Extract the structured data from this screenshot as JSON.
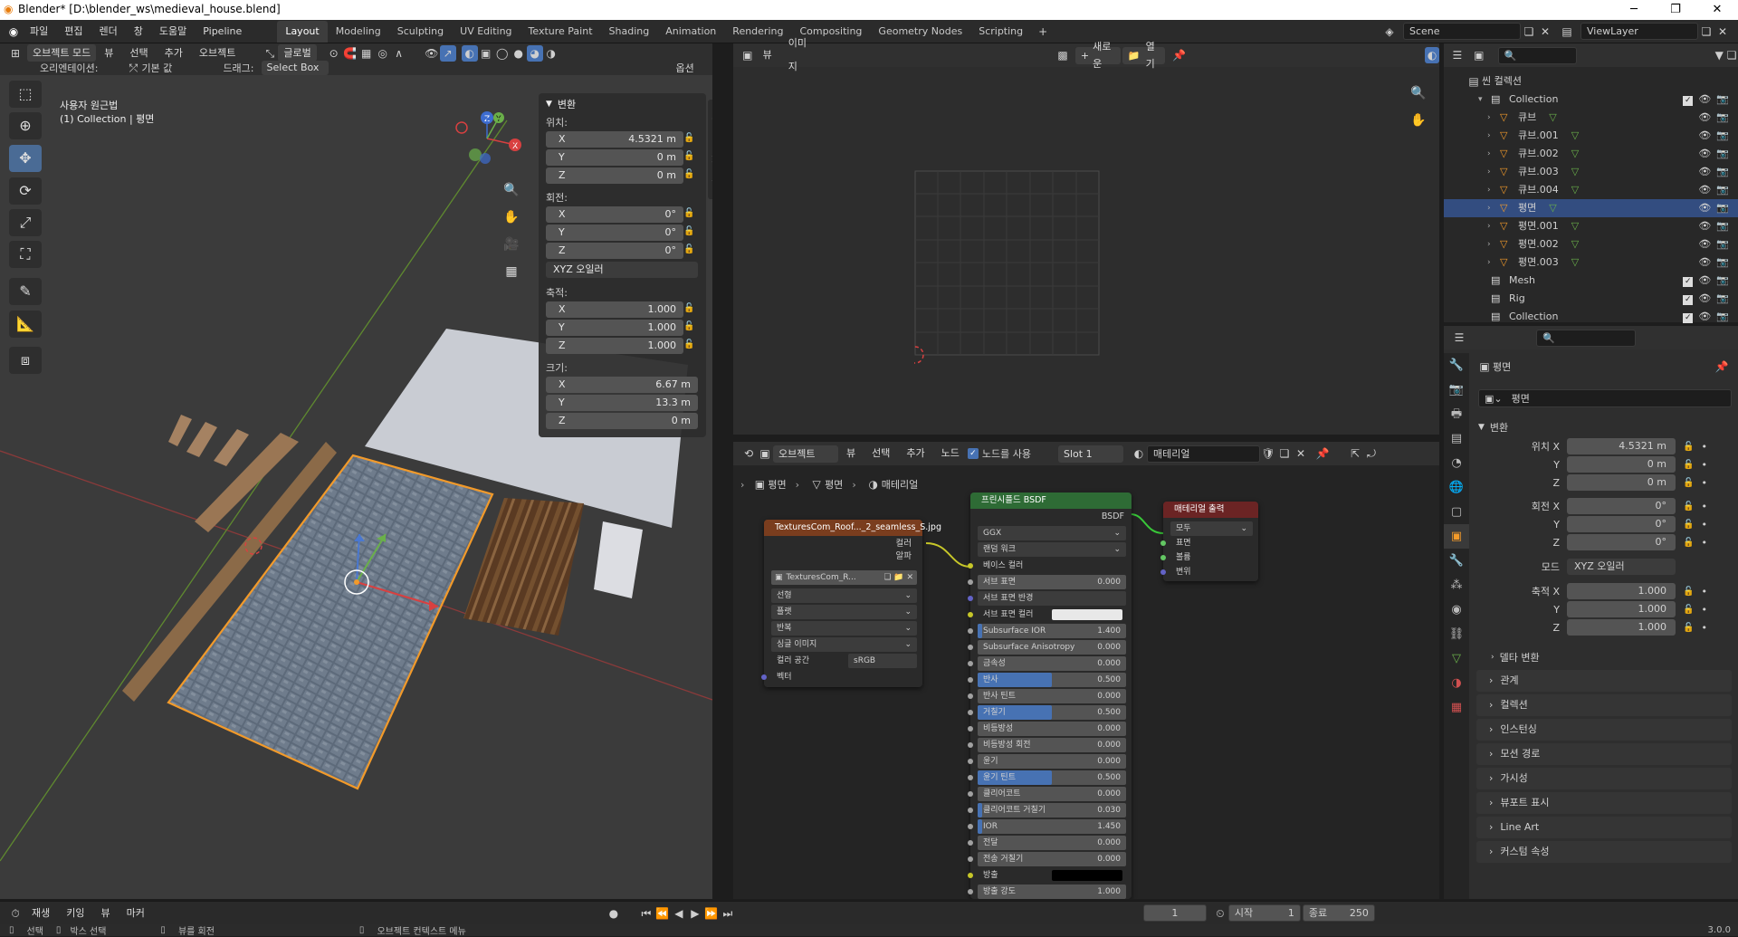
{
  "window": {
    "title": "Blender* [D:\\blender_ws\\medieval_house.blend]"
  },
  "menu": [
    "파일",
    "편집",
    "렌더",
    "창",
    "도움말",
    "Pipeline"
  ],
  "workspaces": [
    "Layout",
    "Modeling",
    "Sculpting",
    "UV Editing",
    "Texture Paint",
    "Shading",
    "Animation",
    "Rendering",
    "Compositing",
    "Geometry Nodes",
    "Scripting"
  ],
  "active_workspace": "Layout",
  "scene": {
    "name": "Scene",
    "view_layer": "ViewLayer"
  },
  "viewport_header": {
    "mode": "오브젝트 모드",
    "view": "뷰",
    "select": "선택",
    "add": "추가",
    "object": "오브젝트",
    "transform": "글로벌",
    "orientation_label": "오리엔테이션:",
    "orientation_value": "기본 값",
    "drag_label": "드래그:",
    "drag_value": "Select Box",
    "options": "옵션"
  },
  "viewport": {
    "line1": "사용자 원근법",
    "line2": "(1) Collection | 평면"
  },
  "npanel": {
    "section": "변환",
    "location_label": "위치:",
    "location": {
      "x": "4.5321 m",
      "y": "0 m",
      "z": "0 m"
    },
    "rotation_label": "회전:",
    "rotation": {
      "x": "0°",
      "y": "0°",
      "z": "0°"
    },
    "rotation_mode": "XYZ 오일러",
    "scale_label": "축적:",
    "scale": {
      "x": "1.000",
      "y": "1.000",
      "z": "1.000"
    },
    "dimensions_label": "크기:",
    "dimensions": {
      "x": "6.67 m",
      "y": "13.3 m",
      "z": "0 m"
    },
    "tabs": [
      "아이템",
      "도구",
      "뷰"
    ]
  },
  "image_editor": {
    "view": "뷰",
    "image": "이미지",
    "new": "새로운",
    "open": "열기"
  },
  "node_editor": {
    "header": {
      "type": "오브젝트",
      "view": "뷰",
      "select": "선택",
      "add": "추가",
      "node": "노드",
      "use_nodes": "노드를 사용",
      "slot": "Slot 1",
      "material": "매테리얼"
    },
    "breadcrumb": [
      "평면",
      "평면",
      "매테리얼"
    ],
    "tex_node": {
      "title": "TexturesCom_Roof..._2_seamless_S.jpg",
      "out_color": "컬러",
      "out_alpha": "알파",
      "image_name": "TexturesCom_R...",
      "interp": "선형",
      "proj": "플랫",
      "ext": "반복",
      "source": "싱글 이미지",
      "colorspace_label": "컬러 공간",
      "colorspace": "sRGB",
      "vector": "벡터"
    },
    "bsdf": {
      "title": "프린시플드 BSDF",
      "out": "BSDF",
      "dist": "GGX",
      "sss_method": "랜덤 워크",
      "base_color": "베이스 컬러",
      "rows": [
        {
          "label": "서브 표면",
          "value": "0.000",
          "fill": 0
        },
        {
          "label": "서브 표면 반경",
          "value": "",
          "fill": 0
        },
        {
          "label": "서브 표면 컬러",
          "value": "",
          "fill": 0
        },
        {
          "label": "Subsurface IOR",
          "value": "1.400",
          "fill": 0.03
        },
        {
          "label": "Subsurface Anisotropy",
          "value": "0.000",
          "fill": 0
        },
        {
          "label": "금속성",
          "value": "0.000",
          "fill": 0
        },
        {
          "label": "반사",
          "value": "0.500",
          "fill": 0.5
        },
        {
          "label": "반사 틴트",
          "value": "0.000",
          "fill": 0
        },
        {
          "label": "거칠기",
          "value": "0.500",
          "fill": 0.5
        },
        {
          "label": "비등방성",
          "value": "0.000",
          "fill": 0
        },
        {
          "label": "비등방성 회전",
          "value": "0.000",
          "fill": 0
        },
        {
          "label": "윤기",
          "value": "0.000",
          "fill": 0
        },
        {
          "label": "윤기 틴트",
          "value": "0.500",
          "fill": 0.5
        },
        {
          "label": "클리어코트",
          "value": "0.000",
          "fill": 0
        },
        {
          "label": "클리어코트 거칠기",
          "value": "0.030",
          "fill": 0.03
        },
        {
          "label": "IOR",
          "value": "1.450",
          "fill": 0.03
        },
        {
          "label": "전달",
          "value": "0.000",
          "fill": 0
        },
        {
          "label": "전송 거칠기",
          "value": "0.000",
          "fill": 0
        },
        {
          "label": "방출",
          "value": "",
          "fill": 0
        },
        {
          "label": "방출 강도",
          "value": "1.000",
          "fill": 0
        },
        {
          "label": "알파",
          "value": "1.000",
          "fill": 1
        },
        {
          "label": "노멀",
          "value": "",
          "fill": 0
        }
      ]
    },
    "output": {
      "title": "매테리얼 출력",
      "target": "모두",
      "surface": "표면",
      "volume": "볼륨",
      "displacement": "변위"
    }
  },
  "outliner": {
    "scene_collection": "씬 컬렉션",
    "items": [
      {
        "name": "Collection",
        "level": 0,
        "kind": "coll"
      },
      {
        "name": "큐브",
        "level": 1,
        "kind": "obj"
      },
      {
        "name": "큐브.001",
        "level": 1,
        "kind": "obj"
      },
      {
        "name": "큐브.002",
        "level": 1,
        "kind": "obj"
      },
      {
        "name": "큐브.003",
        "level": 1,
        "kind": "obj"
      },
      {
        "name": "큐브.004",
        "level": 1,
        "kind": "obj"
      },
      {
        "name": "평면",
        "level": 1,
        "kind": "obj",
        "selected": true
      },
      {
        "name": "평면.001",
        "level": 1,
        "kind": "obj"
      },
      {
        "name": "평면.002",
        "level": 1,
        "kind": "obj"
      },
      {
        "name": "평면.003",
        "level": 1,
        "kind": "obj"
      },
      {
        "name": "Mesh",
        "level": 0,
        "kind": "coll"
      },
      {
        "name": "Rig",
        "level": 0,
        "kind": "coll"
      },
      {
        "name": "Collection",
        "level": 0,
        "kind": "coll"
      }
    ]
  },
  "properties": {
    "object_name": "평면",
    "data_name": "평면",
    "transform": "변환",
    "loc_label": "위치 X",
    "loc": [
      "4.5321 m",
      "0 m",
      "0 m"
    ],
    "rot_label": "회전 X",
    "rot": [
      "0°",
      "0°",
      "0°"
    ],
    "mode_label": "모드",
    "mode": "XYZ 오일러",
    "scale_label": "축적 X",
    "scale": [
      "1.000",
      "1.000",
      "1.000"
    ],
    "y": "Y",
    "z": "Z",
    "delta": "델타 변환",
    "sections": [
      "관계",
      "컬렉션",
      "인스턴싱",
      "모션 경로",
      "가시성",
      "뷰포트 표시",
      "Line Art",
      "커스텀 속성"
    ]
  },
  "timeline": {
    "play": "재생",
    "keying": "키잉",
    "view": "뷰",
    "marker": "마커",
    "frame": "1",
    "start_label": "시작",
    "start": "1",
    "end_label": "종료",
    "end": "250"
  },
  "status": {
    "select": "선택",
    "box": "박스 선택",
    "rotate": "뷰를 회전",
    "ctx": "오브젝트 컨텍스트 메뉴",
    "version": "3.0.0"
  }
}
